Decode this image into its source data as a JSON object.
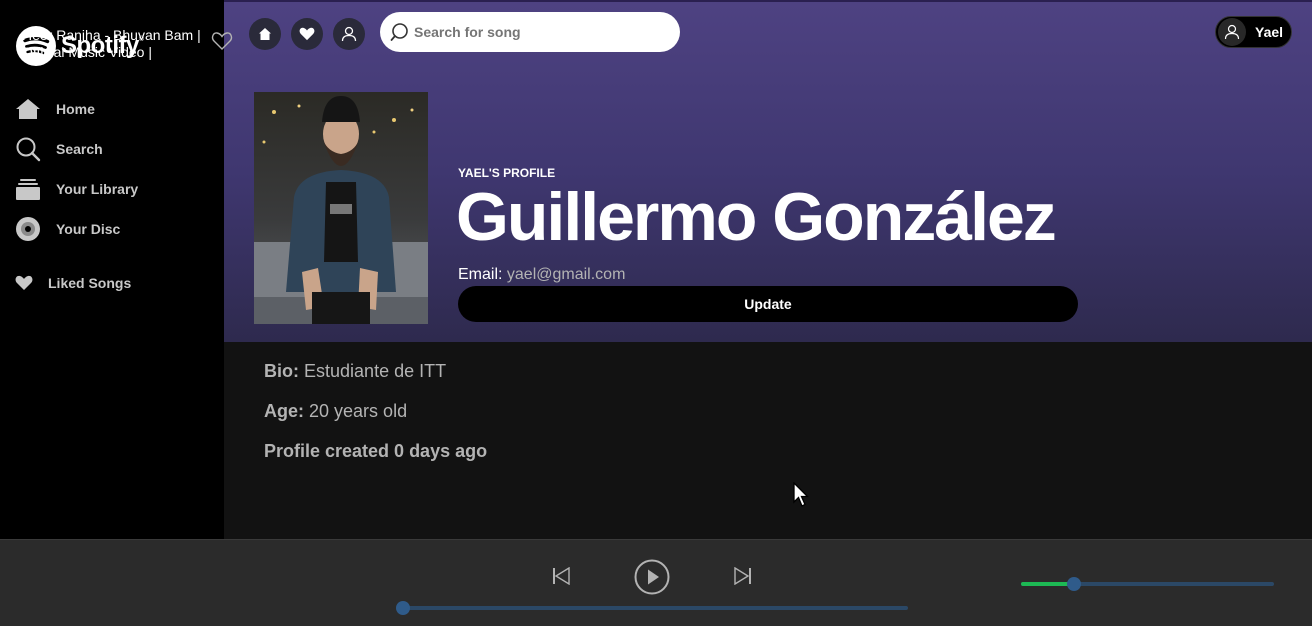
{
  "brand": {
    "name": "Spotify",
    "reg": "®"
  },
  "sidebar": {
    "items": [
      {
        "label": "Home",
        "icon": "home-icon"
      },
      {
        "label": "Search",
        "icon": "search-icon"
      },
      {
        "label": "Your Library",
        "icon": "library-icon"
      },
      {
        "label": "Your Disc",
        "icon": "disc-icon"
      }
    ],
    "liked": {
      "label": "Liked Songs",
      "icon": "heart-icon"
    }
  },
  "topbar": {
    "search_placeholder": "Search for song",
    "user_name": "Yael"
  },
  "profile": {
    "kicker": "YAEL'S PROFILE",
    "name": "Guillermo González",
    "email_label": "Email:",
    "email": "yael@gmail.com",
    "update_label": "Update",
    "bio_label": "Bio:",
    "bio": "Estudiante de ITT",
    "age_label": "Age:",
    "age": "20 years old",
    "created": "Profile created 0 days ago"
  },
  "player": {
    "track_title": "Heer Ranjha - Bhuvan Bam | Official Music Video |",
    "progress": 0,
    "volume": 0.21
  },
  "colors": {
    "accent": "#1db954",
    "header_gradient_top": "#4e4282",
    "slider_track": "#2b4866"
  }
}
